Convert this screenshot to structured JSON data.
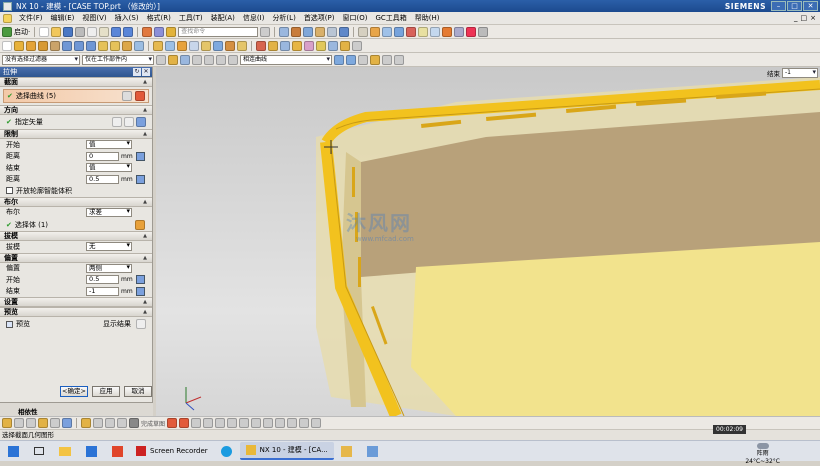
{
  "window": {
    "title": "NX 10 - 建模 - [CASE TOP.prt （修改的）]",
    "brand": "SIEMENS",
    "controls": [
      "–",
      "□",
      "✕"
    ]
  },
  "menu": {
    "items": [
      "文件(F)",
      "编辑(E)",
      "视图(V)",
      "插入(S)",
      "格式(R)",
      "工具(T)",
      "装配(A)",
      "信息(I)",
      "分析(L)",
      "首选项(P)",
      "窗口(O)",
      "GC工具箱",
      "帮助(H)"
    ],
    "right": [
      "_",
      "□",
      "×"
    ]
  },
  "toolbar1": {
    "start_label": "启动·",
    "search_placeholder": "查找命令"
  },
  "filterbar": {
    "selection_filter": "没有选择过滤器",
    "scope": "仅在工作部件内",
    "curve_rule": "相连曲线"
  },
  "viewport": {
    "topright_label": "结束",
    "topright_value": "-1",
    "watermark": "沐风网",
    "watermark_url": "www.mfcad.com"
  },
  "panel": {
    "title": "拉伸",
    "sections": {
      "section": "截面",
      "direction": "方向",
      "limits": "限制",
      "boolean": "布尔",
      "draft": "拔模",
      "offset": "偏置",
      "settings": "设置",
      "preview": "预览"
    },
    "select_curve": "选择曲线 (5)",
    "specify_vector": "指定矢量",
    "start_label": "开始",
    "start_value": "值",
    "distance_label": "距离",
    "distance1_value": "0",
    "distance1_unit": "mm",
    "end_label": "结束",
    "end_value": "值",
    "distance2_label": "距离",
    "distance2_value": "0.5",
    "open_profile": "开放轮廓智能体积",
    "boolean_label": "布尔",
    "boolean_value": "求差",
    "select_body": "选择体 (1)",
    "draft_label": "拔模",
    "draft_value": "无",
    "offset_label": "偏置",
    "offset_value": "两侧",
    "offset_start_label": "开始",
    "offset_start_value": "0.5",
    "offset_start_unit": "mm",
    "offset_end_label": "结束",
    "offset_end_value": "-1",
    "offset_end_unit": "mm",
    "preview_check": "预览",
    "show_result": "显示结果",
    "ok": "<确定>",
    "apply": "应用",
    "cancel": "取消",
    "collapsed_tab": "相依性"
  },
  "bottombar": {
    "label": "完成草图"
  },
  "status": {
    "text": "选择截面几何图形"
  },
  "taskbar": {
    "screen_recorder": "Screen Recorder",
    "nx": "NX 10 - 建模 - [CA...",
    "timer": "00:02:09"
  },
  "weather": {
    "line1": "阵雨",
    "line2": "24°C~32°C"
  },
  "clock": {
    "time": "",
    "date": ""
  },
  "colors": {
    "accent": "#2f568f",
    "yellow": "#f2c21e",
    "orange": "#f3c9a8"
  }
}
